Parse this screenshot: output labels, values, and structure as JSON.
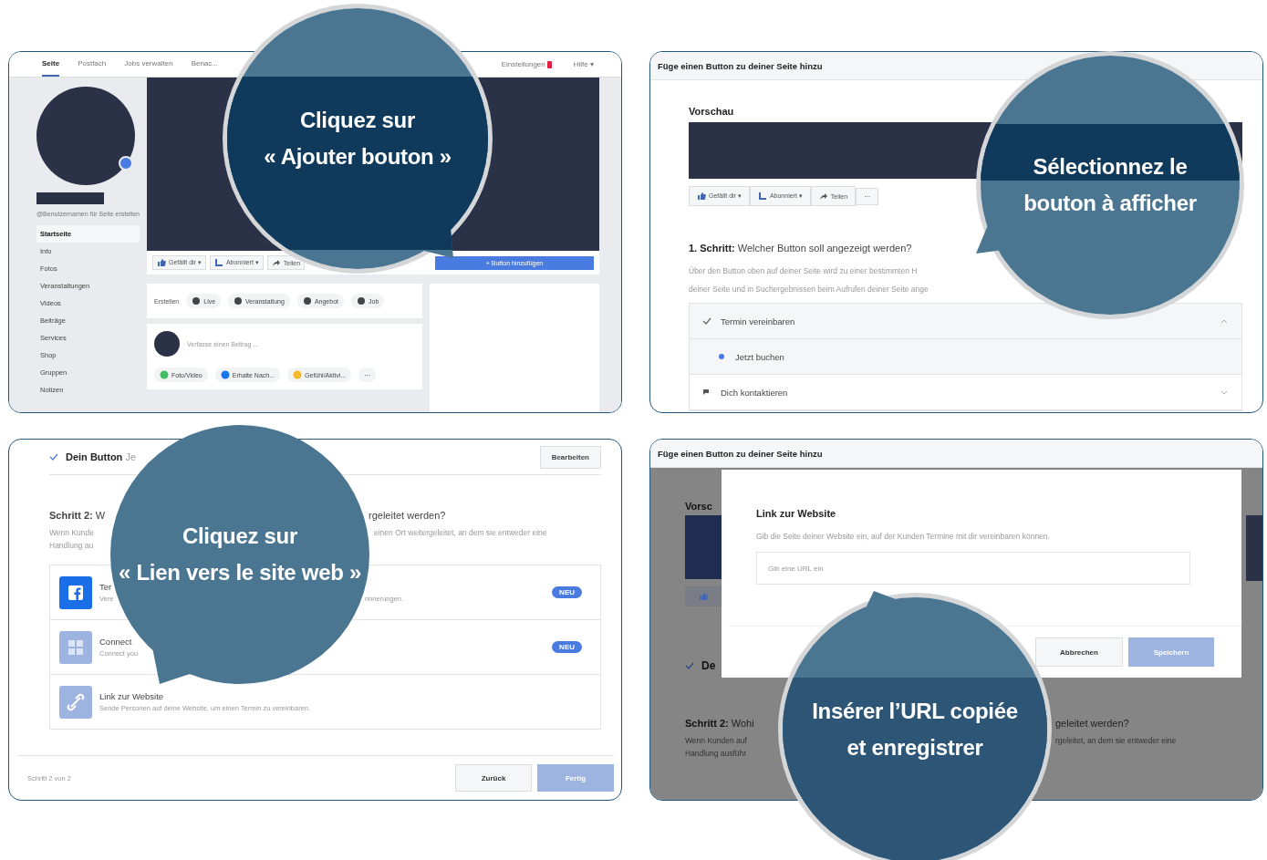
{
  "panels": [
    {
      "kind": "page",
      "nav": {
        "tabs": [
          {
            "label": "Seite",
            "selected": true
          },
          {
            "label": "Postfach",
            "selected": false
          },
          {
            "label": "Jobs verwalten",
            "selected": false
          },
          {
            "label": "Benac...",
            "selected": false
          }
        ],
        "right": [
          {
            "label": "Einstellungen",
            "badge": true
          },
          {
            "label": "Hilfe ▾",
            "badge": false
          }
        ]
      },
      "sidebar": {
        "handle": "@Benutzernamen für Seite erstellen",
        "items": [
          {
            "label": "Startseite",
            "selected": true
          },
          {
            "label": "Info",
            "selected": false
          },
          {
            "label": "Fotos",
            "selected": false
          },
          {
            "label": "Veranstaltungen",
            "selected": false
          },
          {
            "label": "Videos",
            "selected": false
          },
          {
            "label": "Beiträge",
            "selected": false
          },
          {
            "label": "Services",
            "selected": false
          },
          {
            "label": "Shop",
            "selected": false
          },
          {
            "label": "Gruppen",
            "selected": false
          },
          {
            "label": "Notizen",
            "selected": false
          }
        ]
      },
      "actions": [
        "Gefällt dir ▾",
        "Abonniert ▾",
        "Teilen"
      ],
      "primary_button": "+ Button hinzufügen",
      "create": {
        "label": "Erstellen",
        "items": [
          "Live",
          "Veranstaltung",
          "Angebot",
          "Job"
        ]
      },
      "composer": {
        "placeholder": "Verfasse einen Beitrag ...",
        "chips": [
          "Foto/Video",
          "Erhalte Nach...",
          "Gefühl/Aktivi...",
          "···"
        ]
      }
    },
    {
      "kind": "button_picker",
      "title": "Füge einen Button zu deiner Seite hinzu",
      "preview_label": "Vorschau",
      "actions": [
        "Gefällt dir ▾",
        "Abonniert ▾",
        "Teilen",
        "···"
      ],
      "step": "**1. Schritt:** Welcher Button soll angezeigt werden?",
      "description_lines": [
        "Über den Button oben auf deiner Seite wird zu einer bestimmten H",
        "deiner Seite und in Suchergebnissen beim Aufrufen deiner Seite ange"
      ],
      "options": [
        {
          "label": "Termin vereinbaren",
          "expanded": true,
          "children": [
            {
              "label": "Jetzt buchen"
            }
          ]
        },
        {
          "label": "Dich kontaktieren",
          "expanded": false
        }
      ]
    },
    {
      "kind": "destination_picker",
      "chosen": "**Dein Button** Je",
      "edit_button": "Bearbeiten",
      "step": {
        "left": "**Schritt 2:** W",
        "right": "rgeleitet werden?"
      },
      "description": [
        {
          "left": "Wenn Kunde",
          "right": "einen Ort weitergeleitet, an dem sie entweder eine"
        },
        {
          "left": "Handlung au"
        }
      ],
      "options": [
        {
          "kind": "facebook",
          "title": {
            "left": "Ter"
          },
          "subtitle": {
            "left": "Vere",
            "right": "rinnerungen."
          },
          "badge": "NEU"
        },
        {
          "kind": "tool",
          "title": {
            "left": "Connect"
          },
          "subtitle": {
            "left": "Connect you"
          },
          "badge": "NEU"
        },
        {
          "kind": "link",
          "title": {
            "left": "Link zur Website"
          },
          "subtitle": {
            "left": "Sende Personen auf deine Website, um einen Termin zu vereinbaren."
          }
        }
      ],
      "progress": "Schritt 2 von 2",
      "back_button": "Zurück",
      "done_button": "Fertig"
    },
    {
      "kind": "url_dialog",
      "title": "Füge einen Button zu deiner Seite hinzu",
      "background": {
        "preview_label": "Vorsc",
        "chosen": "De",
        "step": {
          "left": "**Schritt 2:** Wohi",
          "right": "geleitet werden?"
        },
        "description": [
          {
            "left": "Wenn Kunden auf",
            "right": "rgeleitet, an dem sie entweder eine"
          },
          {
            "left": "Handlung ausführ"
          }
        ]
      },
      "dialog": {
        "title": "Link zur Website",
        "description": "Gib die Seite deiner Website ein, auf der Kunden Termine mit dir vereinbaren können.",
        "placeholder": "Gib eine URL ein",
        "cancel": "Abbrechen",
        "save": "Speichern"
      }
    }
  ],
  "callouts": [
    {
      "lines": [
        "Cliquez sur",
        "« Ajouter bouton »"
      ],
      "ring": true
    },
    {
      "lines": [
        "Sélectionnez le",
        "bouton à afficher"
      ],
      "ring": true
    },
    {
      "lines": [
        "Cliquez sur",
        "« Lien vers le site web »"
      ],
      "ring": false
    },
    {
      "lines": [
        "Insérer l’URL copiée",
        "et enregistrer"
      ],
      "ring": true
    }
  ]
}
